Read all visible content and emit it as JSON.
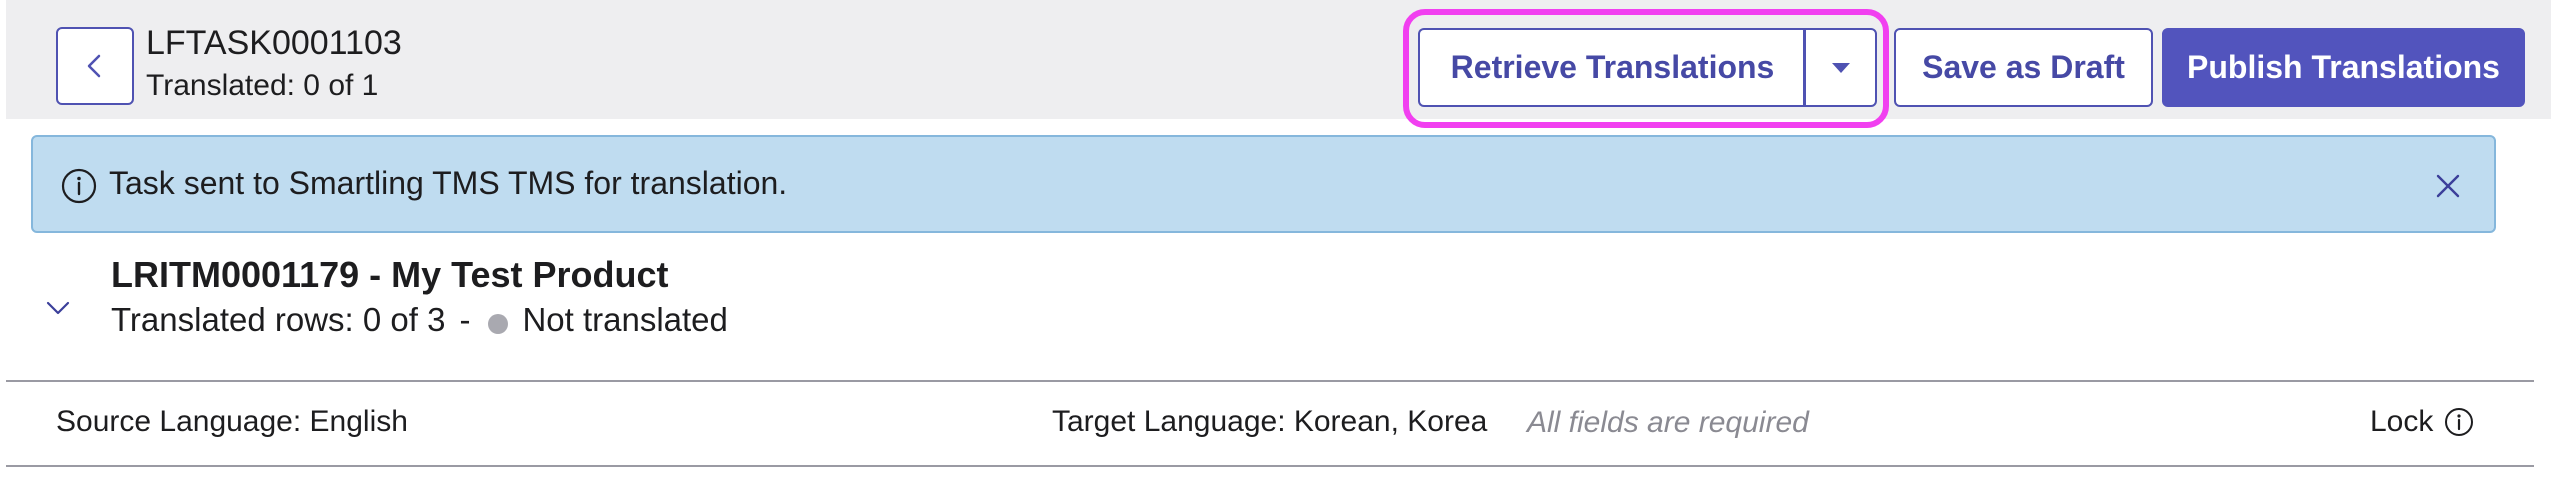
{
  "header": {
    "task_id": "LFTASK0001103",
    "translated_status": "Translated: 0 of 1",
    "buttons": {
      "retrieve": "Retrieve Translations",
      "save_draft": "Save as Draft",
      "publish": "Publish Translations"
    }
  },
  "banner": {
    "message": "Task sent to Smartling TMS TMS for translation."
  },
  "item": {
    "title": "LRITM0001179 - My Test Product",
    "rows_status": "Translated rows: 0 of 3",
    "separator": "-",
    "state": "Not translated"
  },
  "languages": {
    "source": "Source Language: English",
    "target": "Target Language: Korean, Korea",
    "required_note": "All fields are required",
    "lock_label": "Lock"
  },
  "colors": {
    "accent": "#4f52b2",
    "publish_bg": "#5254bd",
    "banner_bg": "#bfdcf0",
    "highlight": "#f13ff0"
  },
  "icons": {
    "back": "chevron-left-icon",
    "dropdown": "caret-down-icon",
    "info": "info-icon",
    "close": "close-icon",
    "expand": "chevron-down-icon"
  }
}
